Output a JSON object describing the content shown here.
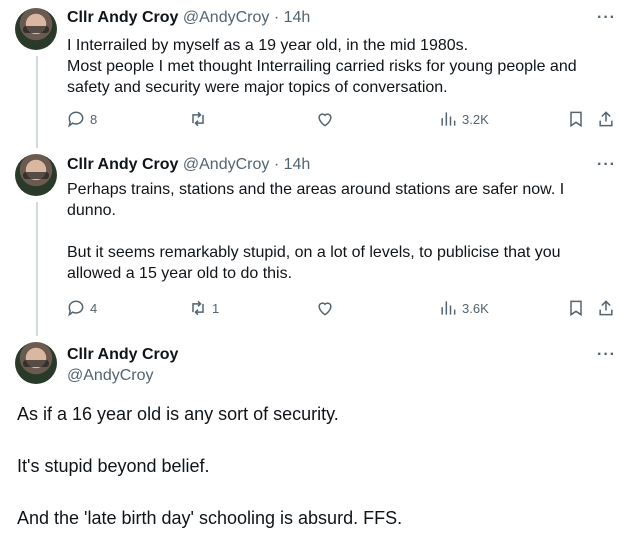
{
  "tweets": [
    {
      "name": "Cllr Andy Croy",
      "handle": "@AndyCroy",
      "time": "· 14h",
      "text": [
        "I Interrailed by myself as a 19 year old, in the mid 1980s.",
        "Most people I met thought Interrailing carried risks for young people and",
        "safety and security were major topics of conversation."
      ],
      "replies": "8",
      "retweets": "",
      "views": "3.2K"
    },
    {
      "name": "Cllr Andy Croy",
      "handle": "@AndyCroy",
      "time": "· 14h",
      "text": [
        "Perhaps trains, stations and the areas around stations are safer now. I",
        "dunno.",
        "",
        "But it seems remarkably stupid,  on a lot of levels,  to publicise that you",
        "allowed a 15 year old to do this."
      ],
      "replies": "4",
      "retweets": "1",
      "views": "3.6K"
    }
  ],
  "main_tweet": {
    "name": "Cllr Andy Croy",
    "handle": "@AndyCroy",
    "text": [
      "As if a 16 year old is any sort of security.",
      "It's stupid beyond belief.",
      "And the 'late birth day' schooling is absurd. FFS."
    ]
  },
  "icons": {
    "reply": "reply-icon",
    "retweet": "retweet-icon",
    "like": "heart-icon",
    "views": "views-icon",
    "bookmark": "bookmark-icon",
    "share": "share-icon",
    "more": "more-icon"
  },
  "more_label": "···"
}
